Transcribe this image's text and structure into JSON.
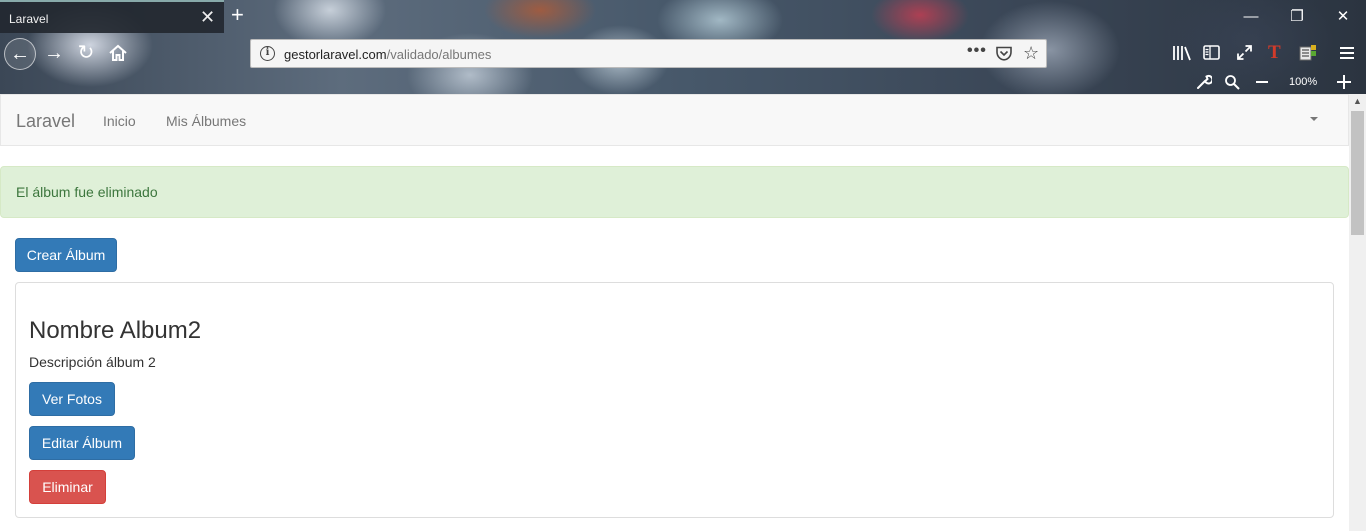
{
  "browser": {
    "tab_title": "Laravel",
    "tab_close": "✕",
    "new_tab": "+",
    "window_controls": {
      "minimize": "—",
      "restore": "❐",
      "close": "✕"
    },
    "url_domain": "gestorlaravel.com",
    "url_path": "/validado/albumes",
    "url_more": "•••",
    "zoom": "100%",
    "icons": [
      "back-arrow-icon",
      "forward-arrow-icon",
      "reload-icon",
      "home-icon",
      "info-icon",
      "page-actions-icon",
      "pocket-icon",
      "bookmark-star-icon",
      "library-icon",
      "sidebar-icon",
      "fullscreen-icon",
      "extension-t-icon",
      "extension-reader-icon",
      "hamburger-menu-icon",
      "wrench-icon",
      "magnifier-icon",
      "zoom-out-icon",
      "zoom-in-icon"
    ]
  },
  "navbar": {
    "brand": "Laravel",
    "links": [
      "Inicio",
      "Mis Álbumes"
    ]
  },
  "alert": {
    "message": "El álbum fue eliminado",
    "color": "#3c763d",
    "background": "#dff0d8"
  },
  "actions": {
    "create_label": "Crear Álbum"
  },
  "albums": [
    {
      "name": "Nombre Album2",
      "description": "Descripción álbum 2",
      "view_label": "Ver Fotos",
      "edit_label": "Editar Álbum",
      "delete_label": "Eliminar"
    }
  ],
  "colors": {
    "primary": "#337ab7",
    "danger": "#d9534f"
  }
}
